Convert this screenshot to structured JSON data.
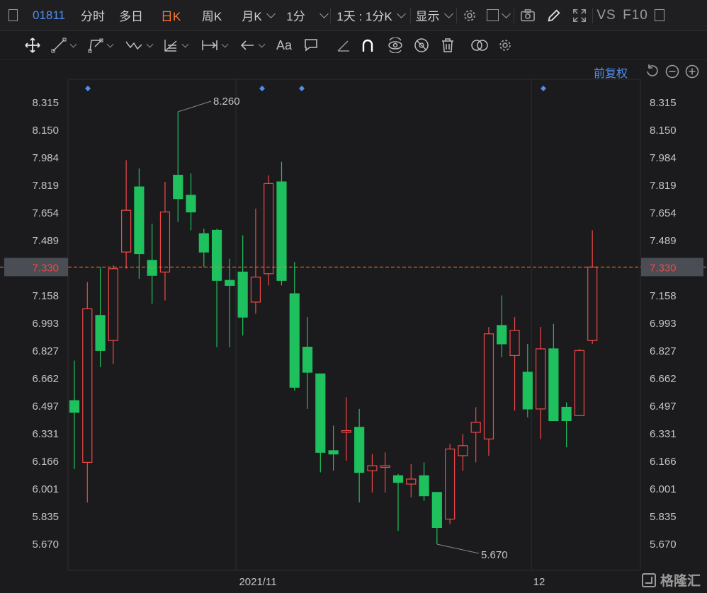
{
  "toolbar": {
    "stock_code": "01811",
    "periods": [
      "分时",
      "多日",
      "日K",
      "周K",
      "月K",
      "1分"
    ],
    "active_period": "日K",
    "interval_select": "1天 : 1分K",
    "display_label": "显示",
    "vs_label": "VS",
    "f10_label": "F10"
  },
  "drawing_tools": {
    "text_tool_label": "Aa"
  },
  "adjust_label": "前复权",
  "colors": {
    "up": "#f04848",
    "down": "#1fc05e",
    "current_price_line": "#ff7a2f",
    "active_period": "#ff7a2f",
    "link_blue": "#4d8ff0"
  },
  "chart_data": {
    "type": "candlestick",
    "current_price": "7.330",
    "y_ticks": [
      "8.315",
      "8.150",
      "7.984",
      "7.819",
      "7.654",
      "7.489",
      "7.330",
      "7.158",
      "6.993",
      "6.827",
      "6.662",
      "6.497",
      "6.331",
      "6.166",
      "6.001",
      "5.835",
      "5.670"
    ],
    "x_labels": [
      "2021/11",
      "12"
    ],
    "high_annotation": "8.260",
    "low_annotation": "5.670",
    "candles": [
      {
        "o": 6.46,
        "c": 6.53,
        "h": 6.77,
        "l": 6.12,
        "dir": "down"
      },
      {
        "o": 6.16,
        "c": 7.08,
        "h": 7.24,
        "l": 5.92,
        "dir": "up"
      },
      {
        "o": 7.04,
        "c": 6.83,
        "h": 7.33,
        "l": 6.73,
        "dir": "down"
      },
      {
        "o": 6.89,
        "c": 7.32,
        "h": 7.34,
        "l": 6.75,
        "dir": "up"
      },
      {
        "o": 7.42,
        "c": 7.67,
        "h": 7.97,
        "l": 7.32,
        "dir": "up"
      },
      {
        "o": 7.81,
        "c": 7.41,
        "h": 7.92,
        "l": 7.26,
        "dir": "down"
      },
      {
        "o": 7.37,
        "c": 7.28,
        "h": 7.59,
        "l": 7.11,
        "dir": "down"
      },
      {
        "o": 7.3,
        "c": 7.66,
        "h": 7.84,
        "l": 7.13,
        "dir": "up"
      },
      {
        "o": 7.88,
        "c": 7.74,
        "h": 8.26,
        "l": 7.6,
        "dir": "down"
      },
      {
        "o": 7.76,
        "c": 7.66,
        "h": 7.89,
        "l": 7.55,
        "dir": "down"
      },
      {
        "o": 7.53,
        "c": 7.42,
        "h": 7.56,
        "l": 7.33,
        "dir": "down"
      },
      {
        "o": 7.55,
        "c": 7.25,
        "h": 7.56,
        "l": 6.85,
        "dir": "down"
      },
      {
        "o": 7.25,
        "c": 7.22,
        "h": 7.38,
        "l": 6.85,
        "dir": "down"
      },
      {
        "o": 7.3,
        "c": 7.03,
        "h": 7.52,
        "l": 6.92,
        "dir": "down"
      },
      {
        "o": 7.12,
        "c": 7.27,
        "h": 7.68,
        "l": 7.05,
        "dir": "up"
      },
      {
        "o": 7.29,
        "c": 7.83,
        "h": 7.88,
        "l": 7.22,
        "dir": "up"
      },
      {
        "o": 7.84,
        "c": 7.25,
        "h": 7.96,
        "l": 7.22,
        "dir": "down"
      },
      {
        "o": 7.17,
        "c": 6.61,
        "h": 7.36,
        "l": 6.59,
        "dir": "down"
      },
      {
        "o": 6.85,
        "c": 6.7,
        "h": 7.03,
        "l": 6.48,
        "dir": "down"
      },
      {
        "o": 6.69,
        "c": 6.22,
        "h": 6.69,
        "l": 6.1,
        "dir": "down"
      },
      {
        "o": 6.23,
        "c": 6.21,
        "h": 6.38,
        "l": 6.11,
        "dir": "down"
      },
      {
        "o": 6.34,
        "c": 6.35,
        "h": 6.55,
        "l": 6.17,
        "dir": "up"
      },
      {
        "o": 6.37,
        "c": 6.1,
        "h": 6.48,
        "l": 5.92,
        "dir": "down"
      },
      {
        "o": 6.11,
        "c": 6.14,
        "h": 6.21,
        "l": 5.98,
        "dir": "up"
      },
      {
        "o": 6.13,
        "c": 6.14,
        "h": 6.22,
        "l": 5.98,
        "dir": "up"
      },
      {
        "o": 6.08,
        "c": 6.04,
        "h": 6.09,
        "l": 5.75,
        "dir": "down"
      },
      {
        "o": 6.03,
        "c": 6.06,
        "h": 6.15,
        "l": 5.95,
        "dir": "up"
      },
      {
        "o": 6.08,
        "c": 5.96,
        "h": 6.16,
        "l": 5.93,
        "dir": "down"
      },
      {
        "o": 5.98,
        "c": 5.77,
        "h": 5.98,
        "l": 5.67,
        "dir": "down"
      },
      {
        "o": 5.82,
        "c": 6.24,
        "h": 6.27,
        "l": 5.79,
        "dir": "up"
      },
      {
        "o": 6.2,
        "c": 6.26,
        "h": 6.33,
        "l": 6.11,
        "dir": "up"
      },
      {
        "o": 6.34,
        "c": 6.4,
        "h": 6.49,
        "l": 6.16,
        "dir": "up"
      },
      {
        "o": 6.3,
        "c": 6.93,
        "h": 6.97,
        "l": 6.2,
        "dir": "up"
      },
      {
        "o": 6.98,
        "c": 6.87,
        "h": 7.16,
        "l": 6.79,
        "dir": "down"
      },
      {
        "o": 6.8,
        "c": 6.95,
        "h": 7.03,
        "l": 6.47,
        "dir": "up"
      },
      {
        "o": 6.7,
        "c": 6.48,
        "h": 6.87,
        "l": 6.43,
        "dir": "down"
      },
      {
        "o": 6.48,
        "c": 6.84,
        "h": 6.97,
        "l": 6.3,
        "dir": "up"
      },
      {
        "o": 6.84,
        "c": 6.41,
        "h": 6.99,
        "l": 6.41,
        "dir": "down"
      },
      {
        "o": 6.49,
        "c": 6.41,
        "h": 6.52,
        "l": 6.25,
        "dir": "down"
      },
      {
        "o": 6.44,
        "c": 6.83,
        "h": 6.84,
        "l": 6.44,
        "dir": "up"
      },
      {
        "o": 6.89,
        "c": 7.33,
        "h": 7.55,
        "l": 6.87,
        "dir": "up"
      }
    ]
  }
}
